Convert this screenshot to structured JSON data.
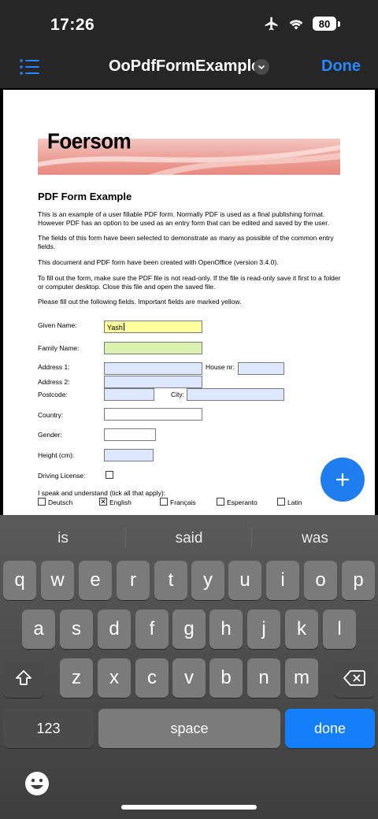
{
  "status": {
    "time": "17:26",
    "battery": "80"
  },
  "nav": {
    "title": "OoPdfFormExample",
    "done": "Done"
  },
  "doc": {
    "logo": "Foersom",
    "heading": "PDF Form Example",
    "paragraphs": [
      "This is an example of a user fillable PDF form. Normally PDF is used as a final publishing format. However PDF has an option to be used as an entry form that can be edited and saved by the user.",
      "The fields of this form have been selected to demonstrate as many as possible of the common entry fields.",
      "This document and PDF form have been created with OpenOffice (version 3.4.0).",
      "To fill out the form, make sure the PDF file is not read-only. If the file is read-only save it first to a folder or computer desktop. Close this file and open the saved file.",
      "Please fill out the following fields. Important fields are marked yellow."
    ],
    "labels": {
      "given_name": "Given Name:",
      "family_name": "Family Name:",
      "address1": "Address 1:",
      "house_nr": "House nr:",
      "address2": "Address 2:",
      "postcode": "Postcode:",
      "city": "City:",
      "country": "Country:",
      "gender": "Gender:",
      "height": "Height (cm):",
      "driving_license": "Driving License:",
      "languages_prompt": "I speak and understand (tick all that apply):"
    },
    "values": {
      "given_name": "Yash"
    },
    "languages": [
      {
        "label": "Deutsch",
        "checked": false
      },
      {
        "label": "English",
        "checked": true
      },
      {
        "label": "Français",
        "checked": false
      },
      {
        "label": "Esperanto",
        "checked": false
      },
      {
        "label": "Latin",
        "checked": false
      }
    ]
  },
  "keyboard": {
    "suggestions": [
      "is",
      "said",
      "was"
    ],
    "row1": [
      "q",
      "w",
      "e",
      "r",
      "t",
      "y",
      "u",
      "i",
      "o",
      "p"
    ],
    "row2": [
      "a",
      "s",
      "d",
      "f",
      "g",
      "h",
      "j",
      "k",
      "l"
    ],
    "row3": [
      "z",
      "x",
      "c",
      "v",
      "b",
      "n",
      "m"
    ],
    "numbers_key": "123",
    "space_key": "space",
    "done_key": "done"
  },
  "colors": {
    "accent": "#2a86ff",
    "required_field": "#ffffa0",
    "optional_field": "#dde8ff"
  }
}
